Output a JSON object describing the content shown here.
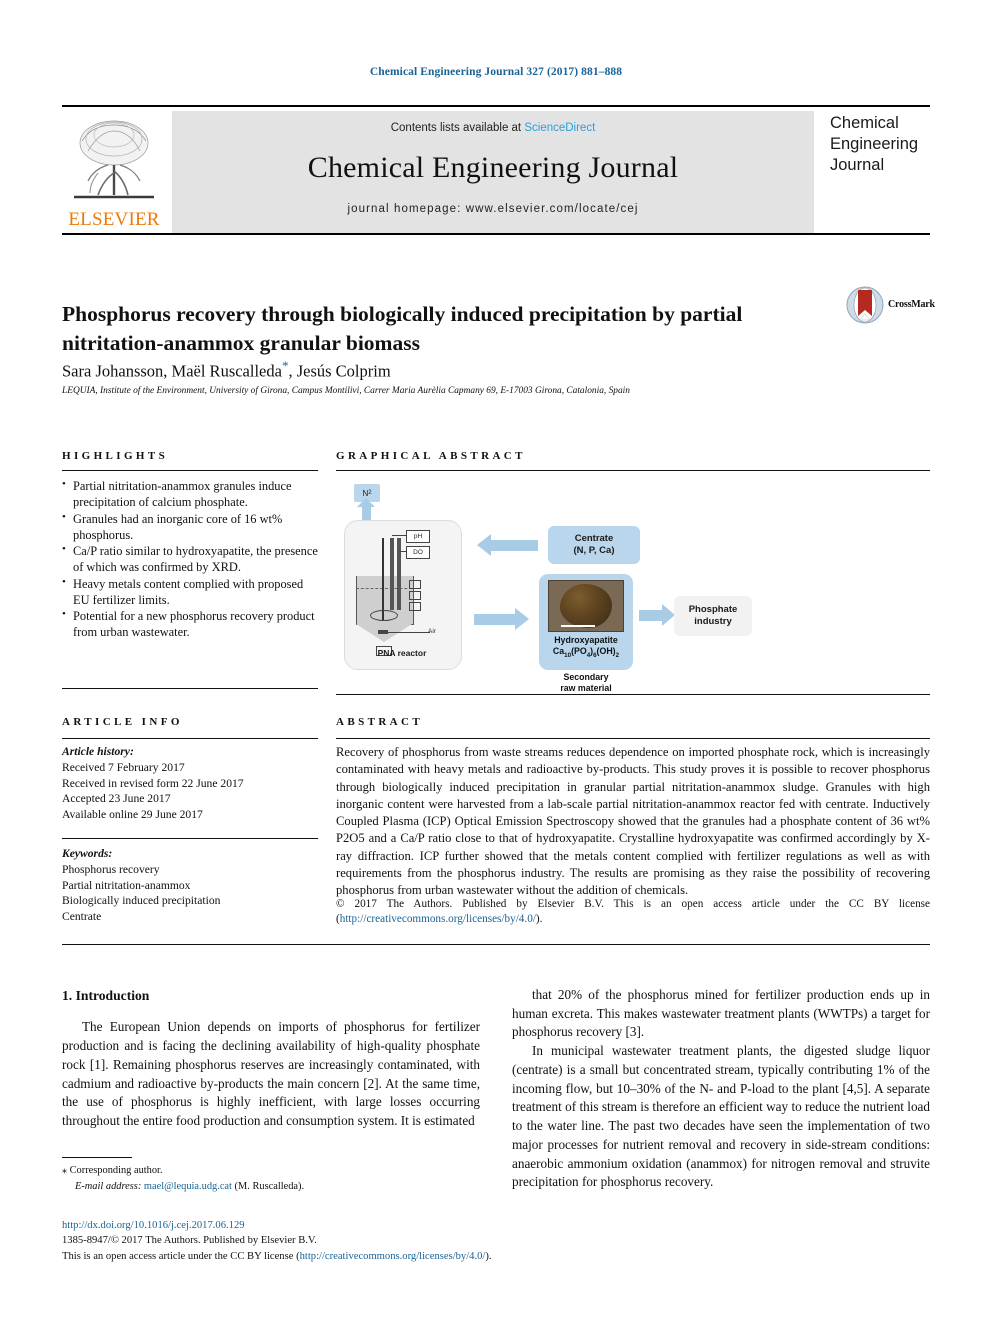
{
  "running_head": "Chemical Engineering Journal 327 (2017) 881–888",
  "masthead": {
    "contents_prefix": "Contents lists available at ",
    "contents_link": "ScienceDirect",
    "journal_title": "Chemical Engineering Journal",
    "homepage": "journal homepage: www.elsevier.com/locate/cej",
    "publisher_wordmark": "ELSEVIER",
    "cover_lines": [
      "Chemical",
      "Engineering",
      "Journal"
    ]
  },
  "article": {
    "title": "Phosphorus recovery through biologically induced precipitation by partial nitritation-anammox granular biomass",
    "authors": "Sara Johansson, Maël Ruscalleda",
    "authors_tail": ", Jesús Colprim",
    "corresponding_marker": "*",
    "affiliation": "LEQUIA, Institute of the Environment, University of Girona, Campus Montilivi, Carrer Maria Aurèlia Capmany 69, E-17003 Girona, Catalonia, Spain"
  },
  "crossmark": {
    "label": "CrossMark"
  },
  "highlights": {
    "heading": "HIGHLIGHTS",
    "items": [
      "Partial nitritation-anammox granules induce precipitation of calcium phosphate.",
      "Granules had an inorganic core of 16 wt% phosphorus.",
      "Ca/P ratio similar to hydroxyapatite, the presence of which was confirmed by XRD.",
      "Heavy metals content complied with proposed EU fertilizer limits.",
      "Potential for a new phosphorus recovery product from urban wastewater."
    ]
  },
  "article_info": {
    "heading": "ARTICLE INFO",
    "history_label": "Article history:",
    "history": [
      "Received 7 February 2017",
      "Received in revised form 22 June 2017",
      "Accepted 23 June 2017",
      "Available online 29 June 2017"
    ],
    "keywords_label": "Keywords:",
    "keywords": [
      "Phosphorus recovery",
      "Partial nitritation-anammox",
      "Biologically induced precipitation",
      "Centrate"
    ]
  },
  "graphical_abstract": {
    "heading": "GRAPHICAL ABSTRACT",
    "nodes": {
      "n2": "N",
      "n2_sub": "2",
      "reactor_label": "PNA reactor",
      "probe_ph": "pH",
      "probe_do": "DO",
      "air_label": "Air",
      "centrate_line1": "Centrate",
      "centrate_line2": "(N, P, Ca)",
      "hap_line1": "Hydroxyapatite",
      "hap_formula_pre": "Ca",
      "hap_formula_sub1": "10",
      "hap_formula_mid": "(PO",
      "hap_formula_sub2": "4",
      "hap_formula_mid2": ")",
      "hap_formula_sub3": "6",
      "hap_formula_end": "(OH)",
      "hap_formula_sub4": "2",
      "secondary_line1": "Secondary",
      "secondary_line2": "raw material",
      "phosphate_line1": "Phosphate",
      "phosphate_line2": "industry"
    }
  },
  "abstract": {
    "heading": "ABSTRACT",
    "text": "Recovery of phosphorus from waste streams reduces dependence on imported phosphate rock, which is increasingly contaminated with heavy metals and radioactive by-products. This study proves it is possible to recover phosphorus through biologically induced precipitation in granular partial nitritation-anammox sludge. Granules with high inorganic content were harvested from a lab-scale partial nitritation-anammox reactor fed with centrate. Inductively Coupled Plasma (ICP) Optical Emission Spectroscopy showed that the granules had a phosphate content of 36 wt% P2O5 and a Ca/P ratio close to that of hydroxyapatite. Crystalline hydroxyapatite was confirmed accordingly by X-ray diffraction. ICP further showed that the metals content complied with fertilizer regulations as well as with requirements from the phosphorus industry. The results are promising as they raise the possibility of recovering phosphorus from urban wastewater without the addition of chemicals.",
    "copyright_text": "© 2017 The Authors. Published by Elsevier B.V. This is an open access article under the CC BY license (",
    "copyright_link": "http://creativecommons.org/licenses/by/4.0/",
    "copyright_close": ")."
  },
  "body": {
    "section_title": "1. Introduction",
    "left_paragraph": "The European Union depends on imports of phosphorus for fertilizer production and is facing the declining availability of high-quality phosphate rock [1]. Remaining phosphorus reserves are increasingly contaminated, with cadmium and radioactive by-products the main concern [2]. At the same time, the use of phosphorus is highly inefficient, with large losses occurring throughout the entire food production and consumption system. It is estimated",
    "right_paragraph_1": "that 20% of the phosphorus mined for fertilizer production ends up in human excreta. This makes wastewater treatment plants (WWTPs) a target for phosphorus recovery [3].",
    "right_paragraph_2": "In municipal wastewater treatment plants, the digested sludge liquor (centrate) is a small but concentrated stream, typically contributing 1% of the incoming flow, but 10–30% of the N- and P-load to the plant [4,5]. A separate treatment of this stream is therefore an efficient way to reduce the nutrient load to the water line. The past two decades have seen the implementation of two major processes for nutrient removal and recovery in side-stream conditions: anaerobic ammonium oxidation (anammox) for nitrogen removal and struvite precipitation for phosphorus recovery."
  },
  "footnote": {
    "star": "⁎",
    "corresponding": "Corresponding author.",
    "email_label": "E-mail address:",
    "email": "mael@lequia.udg.cat",
    "email_owner": "(M. Ruscalleda)."
  },
  "page_footer": {
    "doi": "http://dx.doi.org/10.1016/j.cej.2017.06.129",
    "issn_line": "1385-8947/© 2017 The Authors. Published by Elsevier B.V.",
    "license_pre": "This is an open access article under the CC BY license (",
    "license_link": "http://creativecommons.org/licenses/by/4.0/",
    "license_close": ")."
  },
  "colors": {
    "link": "#1a6496",
    "sciencedirect": "#2b9fd9",
    "elsevier_orange": "#ec7a08",
    "band_gray": "#e3e3e3",
    "diagram_blue": "#b9d6ec"
  }
}
